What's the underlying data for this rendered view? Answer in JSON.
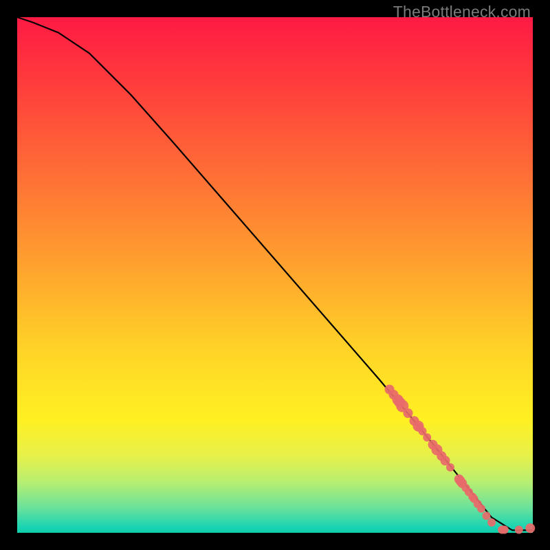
{
  "watermark": "TheBottleneck.com",
  "chart_data": {
    "type": "line",
    "title": "",
    "xlabel": "",
    "ylabel": "",
    "xlim": [
      0,
      100
    ],
    "ylim": [
      0,
      100
    ],
    "curve": {
      "name": "curve",
      "x": [
        0,
        3,
        8,
        14,
        22,
        30,
        40,
        50,
        60,
        70,
        78,
        84,
        88,
        92,
        96,
        100
      ],
      "y": [
        100,
        99,
        97,
        93,
        85,
        76,
        64.5,
        53,
        41.5,
        30,
        20.5,
        13,
        8,
        3,
        0.5,
        0.5
      ]
    },
    "scatter": {
      "name": "points",
      "color": "#e86a6a",
      "x": [
        72.2,
        73.0,
        73.8,
        74.2,
        74.7,
        75.8,
        77.0,
        77.8,
        78.0,
        78.6,
        79.5,
        80.6,
        81.4,
        82.3,
        83.0,
        84.0,
        85.7,
        86.0,
        86.3,
        87.0,
        87.6,
        88.3,
        88.6,
        89.3,
        90.0,
        91.0,
        92.0,
        94.0,
        94.5,
        97.3,
        99.5
      ],
      "y": [
        27.8,
        26.8,
        25.8,
        25.3,
        24.6,
        23.2,
        21.7,
        20.7,
        20.4,
        19.7,
        18.5,
        17.1,
        16.1,
        14.9,
        14.0,
        12.7,
        10.4,
        10.0,
        9.6,
        8.7,
        7.9,
        7.0,
        6.6,
        5.6,
        4.7,
        3.3,
        2.0,
        0.6,
        0.6,
        0.6,
        0.9
      ],
      "r": [
        7,
        7,
        8,
        8,
        9,
        7,
        7,
        8,
        6,
        6,
        6,
        7,
        8,
        7,
        7,
        6,
        7,
        7,
        7,
        6,
        6,
        6,
        6,
        6,
        6,
        6,
        6,
        6,
        6,
        6,
        7
      ]
    }
  }
}
